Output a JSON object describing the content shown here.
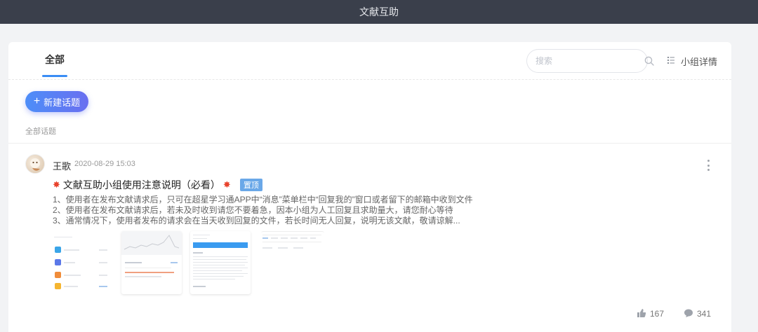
{
  "app": {
    "title": "文献互助"
  },
  "tabs": [
    {
      "label": "全部"
    }
  ],
  "search": {
    "placeholder": "搜索"
  },
  "group_detail": {
    "label": "小组详情"
  },
  "new_topic": {
    "label": "新建话题"
  },
  "section": {
    "label": "全部话题"
  },
  "post": {
    "author": "王歌",
    "time": "2020-08-29 15:03",
    "title": "文献互助小组使用注意说明（必看）",
    "pin_badge": "置顶",
    "body": [
      "1、使用者在发布文献请求后，只可在超星学习通APP中“消息”菜单栏中“回复我的”窗口或者留下的邮箱中收到文件",
      "2、使用者在发布文献请求后，若未及时收到请您不要着急，因本小组为人工回复且求助量大，请您耐心等待",
      "3、通常情况下，使用者发布的请求会在当天收到回复的文件，若长时间无人回复，说明无该文献，敬请谅解..."
    ],
    "likes": "167",
    "comments": "341"
  },
  "colors": {
    "topbar": "#3a3f4b",
    "accent": "#3a8df5",
    "button_gradient_start": "#4d8ef8",
    "button_gradient_end": "#6a6ff0",
    "pin_badge": "#6aa8e8",
    "burst": "#e8432d"
  },
  "icons": {
    "search": "search-icon",
    "group_detail": "list-icon",
    "more": "more-vertical-icon",
    "like": "thumbs-up-icon",
    "comment": "comment-icon",
    "burst": "burst-emoji-icon"
  }
}
